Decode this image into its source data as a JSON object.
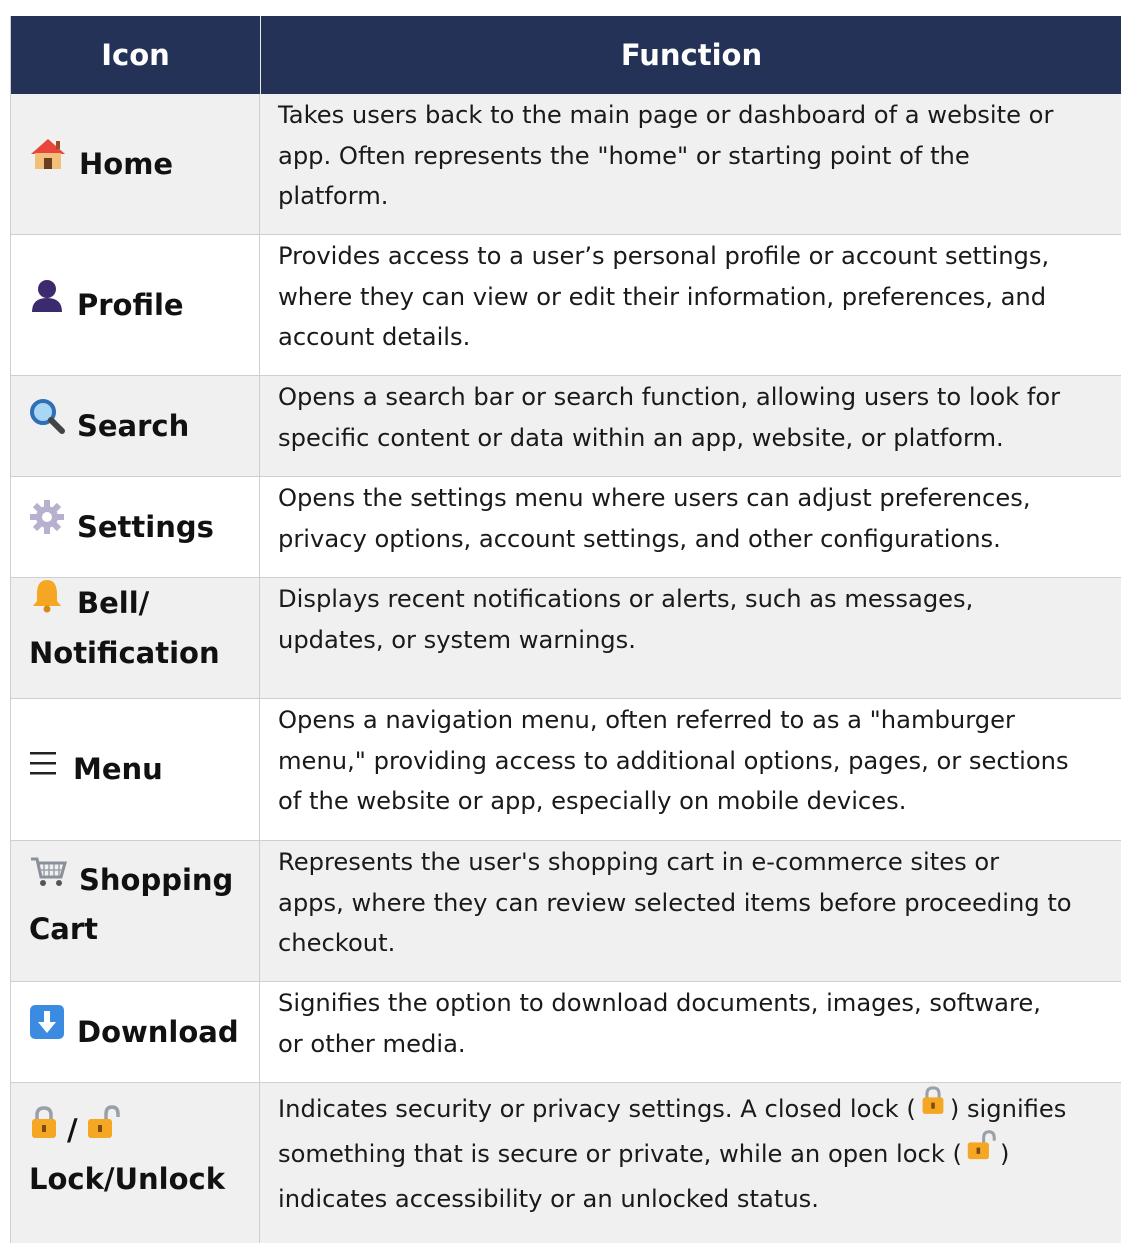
{
  "header": {
    "icon_col": "Icon",
    "function_col": "Function"
  },
  "rows": [
    {
      "icon": "house-icon",
      "name_lines": [
        "Home"
      ],
      "desc_lines": [
        "Takes users back to the main page or dashboard of a website or",
        "app. Often represents the \"home\" or starting point of the",
        "platform."
      ]
    },
    {
      "icon": "person-icon",
      "name_lines": [
        "Profile"
      ],
      "desc_lines": [
        "Provides access to a user’s personal profile or account settings,",
        "where they can view or edit their information, preferences, and",
        "account details."
      ]
    },
    {
      "icon": "magnifier-icon",
      "name_lines": [
        "Search"
      ],
      "desc_lines": [
        "Opens a search bar or search function, allowing users to look for",
        "specific content or data within an app, website, or platform."
      ]
    },
    {
      "icon": "gear-icon",
      "name_lines": [
        "Settings"
      ],
      "desc_lines": [
        "Opens the settings menu where users can adjust preferences,",
        "privacy options, account settings, and other configurations."
      ]
    },
    {
      "icon": "bell-icon",
      "name_lines": [
        "Bell/",
        "Notification"
      ],
      "desc_lines": [
        "Displays recent notifications or alerts, such as messages,",
        "updates, or system warnings."
      ]
    },
    {
      "icon": "hamburger-icon",
      "name_lines": [
        "Menu"
      ],
      "desc_lines": [
        "Opens a navigation menu, often referred to as a \"hamburger",
        "menu,\" providing access to additional options, pages, or sections",
        "of the website or app, especially on mobile devices."
      ]
    },
    {
      "icon": "cart-icon",
      "name_lines": [
        "Shopping",
        "Cart"
      ],
      "desc_lines": [
        "Represents the user's shopping cart in e-commerce sites or",
        "apps, where they can review selected items before proceeding to",
        "checkout."
      ]
    },
    {
      "icon": "download-icon",
      "name_lines": [
        "Download"
      ],
      "desc_lines": [
        "Signifies the option to download documents, images, software,",
        "or other media."
      ]
    },
    {
      "icon": "lock-icon",
      "name_lines": [
        "/",
        "Lock/Unlock"
      ],
      "desc_lines": [
        "Indicates security or privacy settings. A closed lock (",
        ") signifies",
        "something that is secure or private, while an open lock (",
        ")",
        "indicates accessibility or an unlocked status."
      ]
    }
  ]
}
